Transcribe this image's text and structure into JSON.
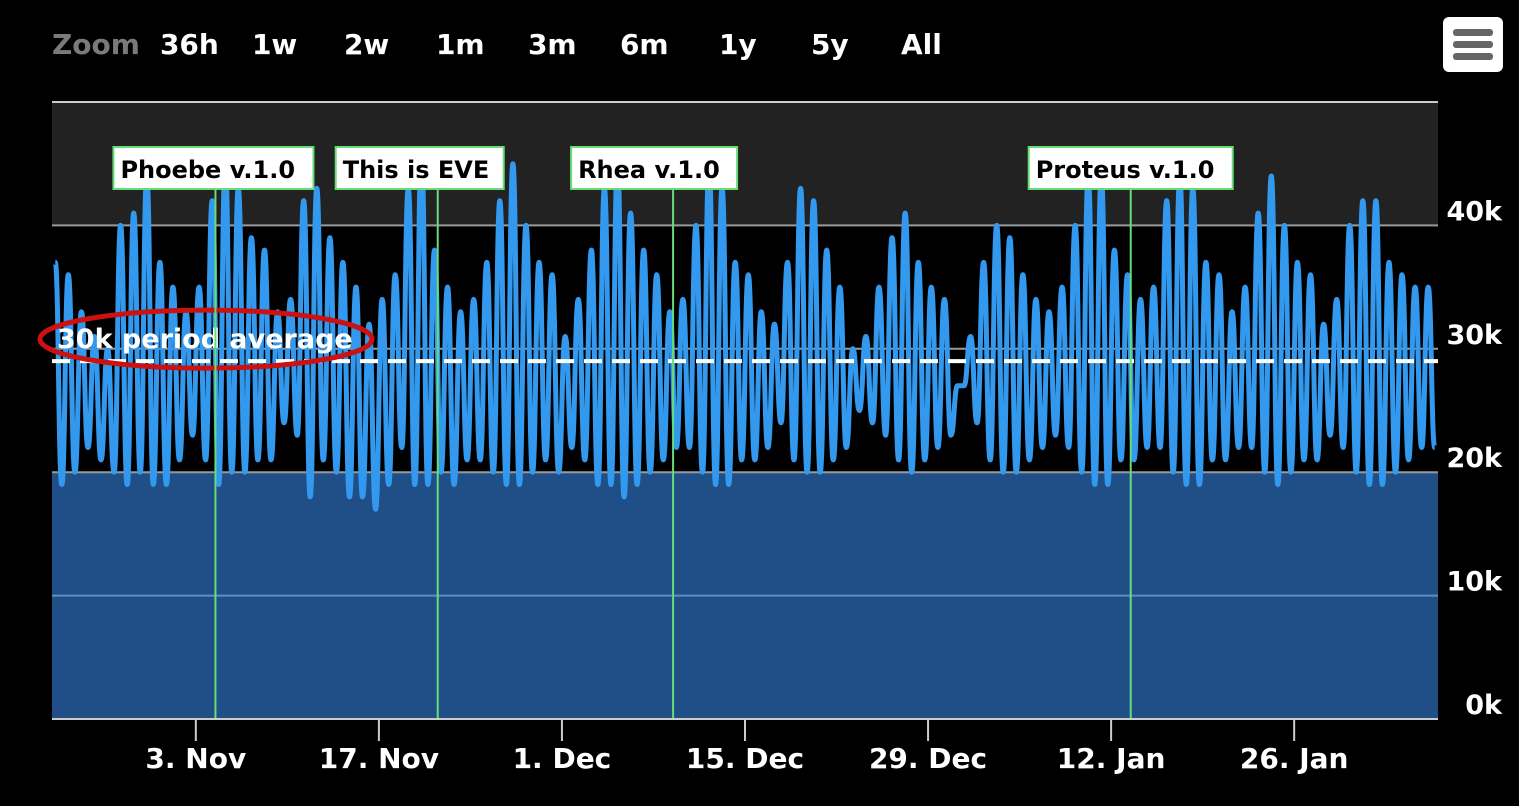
{
  "zoom": {
    "label": "Zoom",
    "buttons": [
      "36h",
      "1w",
      "2w",
      "1m",
      "3m",
      "6m",
      "1y",
      "5y",
      "All"
    ]
  },
  "menu": {
    "icon": "hamburger-menu-icon"
  },
  "chart_data": {
    "type": "area",
    "title": "",
    "xlabel": "",
    "ylabel": "",
    "ylim": [
      0,
      50000
    ],
    "xlim": [
      "2024-10-23",
      "2025-02-06"
    ],
    "y_ticks": [
      0,
      10000,
      20000,
      30000,
      40000
    ],
    "y_tick_labels": [
      "0k",
      "10k",
      "20k",
      "30k",
      "40k"
    ],
    "x_ticks": [
      "2024-11-03",
      "2024-11-17",
      "2024-12-01",
      "2024-12-15",
      "2024-12-29",
      "2025-01-12",
      "2025-01-26"
    ],
    "x_tick_labels": [
      "3. Nov",
      "17. Nov",
      "1. Dec",
      "15. Dec",
      "29. Dec",
      "12. Jan",
      "26. Jan"
    ],
    "grid": true,
    "series": [
      {
        "color": "#3399ee",
        "x_start": "2024-10-23",
        "x_end": "2025-02-06",
        "daily_max": [
          37000,
          36000,
          33000,
          31000,
          30000,
          40000,
          41000,
          44000,
          37000,
          35000,
          33000,
          35000,
          42000,
          45000,
          43000,
          39000,
          38000,
          33000,
          34000,
          42000,
          43000,
          39000,
          37000,
          35000,
          32000,
          34000,
          36000,
          43000,
          46000,
          38000,
          35000,
          33000,
          34000,
          37000,
          42000,
          45000,
          40000,
          37000,
          36000,
          31000,
          34000,
          38000,
          43000,
          45000,
          41000,
          38000,
          36000,
          33000,
          34000,
          40000,
          45000,
          43000,
          37000,
          36000,
          33000,
          32000,
          37000,
          43000,
          42000,
          38000,
          35000,
          30000,
          31000,
          35000,
          39000,
          41000,
          37000,
          35000,
          34000,
          27000,
          31000,
          37000,
          40000,
          39000,
          36000,
          34000,
          33000,
          35000,
          40000,
          44000,
          44000,
          38000,
          36000,
          34000,
          35000,
          42000,
          44000,
          43000,
          37000,
          36000,
          33000,
          35000,
          41000,
          44000,
          40000,
          37000,
          36000,
          32000,
          34000,
          40000,
          42000,
          42000,
          37000,
          36000,
          35000,
          35000
        ],
        "daily_min": [
          19000,
          20000,
          22000,
          21000,
          20000,
          19000,
          20000,
          19000,
          19000,
          21000,
          23000,
          21000,
          19000,
          20000,
          20000,
          21000,
          21000,
          24000,
          23000,
          18000,
          21000,
          20000,
          18000,
          18000,
          17000,
          19000,
          22000,
          19000,
          19000,
          20000,
          19000,
          21000,
          21000,
          20000,
          19000,
          19000,
          20000,
          21000,
          20000,
          22000,
          21000,
          19000,
          19000,
          18000,
          19000,
          20000,
          21000,
          22000,
          22000,
          20000,
          19000,
          19000,
          21000,
          21000,
          22000,
          24000,
          21000,
          20000,
          20000,
          21000,
          22000,
          25000,
          24000,
          23000,
          21000,
          20000,
          21000,
          22000,
          23000,
          27000,
          24000,
          21000,
          20000,
          20000,
          21000,
          22000,
          23000,
          22000,
          20000,
          19000,
          19000,
          21000,
          21000,
          22000,
          22000,
          20000,
          19000,
          19000,
          21000,
          21000,
          22000,
          22000,
          20000,
          19000,
          20000,
          21000,
          21000,
          23000,
          22000,
          20000,
          19000,
          19000,
          20000,
          21000,
          22000,
          22000
        ]
      }
    ],
    "plot_bands": [
      {
        "from": 40000,
        "to": 50000,
        "color": "#222222"
      },
      {
        "from": 20000,
        "to": 40000,
        "color": "#000000"
      },
      {
        "from": 0,
        "to": 20000,
        "color": "#1f4f86"
      }
    ],
    "plot_lines": [
      {
        "value": 29000,
        "style": "dashed",
        "color": "#ffffff",
        "label": "30k period average"
      }
    ],
    "flags": [
      {
        "date": "2024-11-04",
        "label": "Phoebe v.1.0",
        "color": "#66dd77"
      },
      {
        "date": "2024-11-21",
        "label": "This is EVE",
        "color": "#66dd77"
      },
      {
        "date": "2024-12-09",
        "label": "Rhea v.1.0",
        "color": "#66dd77"
      },
      {
        "date": "2025-01-13",
        "label": "Proteus v.1.0",
        "color": "#66dd77"
      }
    ],
    "annotations": [
      {
        "text": "30k period average",
        "shape": "ellipse",
        "color": "#cc1111"
      }
    ]
  }
}
